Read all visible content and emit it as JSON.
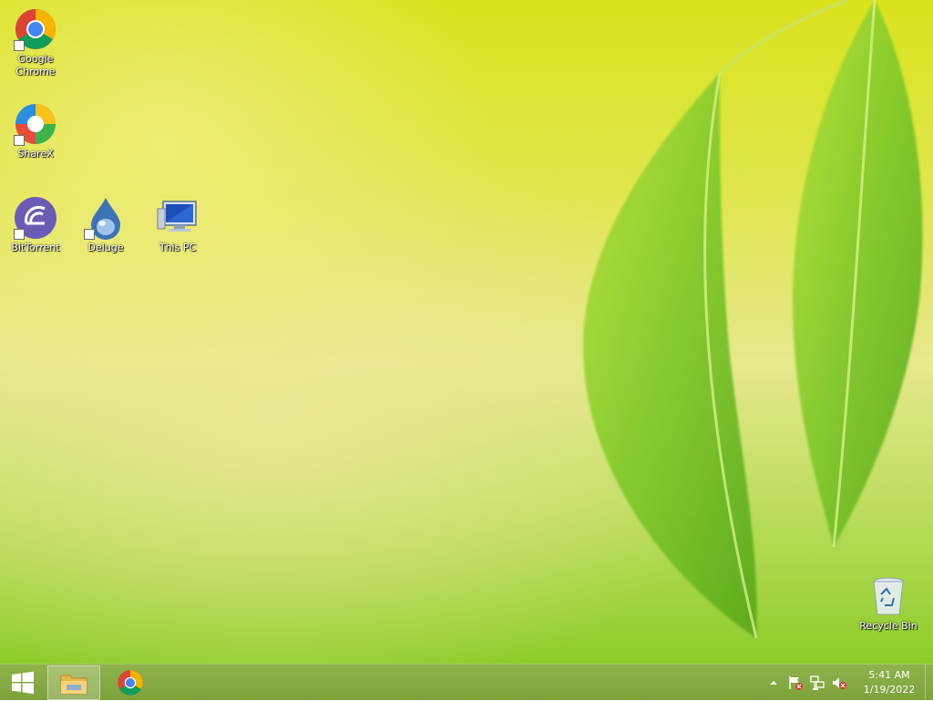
{
  "desktop": {
    "icons": [
      {
        "id": "chrome",
        "label": "Google\nChrome",
        "icon": "chrome-icon",
        "shortcut": true
      },
      {
        "id": "sharex",
        "label": "ShareX",
        "icon": "sharex-icon",
        "shortcut": true
      },
      {
        "id": "bittorrent",
        "label": "BitTorrent",
        "icon": "bittorrent-icon",
        "shortcut": true
      },
      {
        "id": "deluge",
        "label": "Deluge",
        "icon": "deluge-icon",
        "shortcut": true
      },
      {
        "id": "thispc",
        "label": "This PC",
        "icon": "computer-icon",
        "shortcut": false
      },
      {
        "id": "recyclebin",
        "label": "Recycle Bin",
        "icon": "recycle-bin-icon",
        "shortcut": false
      }
    ]
  },
  "taskbar": {
    "start_icon": "windows-logo-icon",
    "pinned": [
      {
        "id": "explorer",
        "icon": "file-explorer-icon",
        "active": true
      },
      {
        "id": "chrome",
        "icon": "chrome-icon",
        "active": false
      }
    ],
    "tray": {
      "icons": [
        "show-hidden-icons-icon",
        "action-center-flag-icon",
        "network-icon",
        "volume-muted-icon"
      ]
    },
    "clock": {
      "time": "5:41 AM",
      "date": "1/19/2022"
    }
  },
  "colors": {
    "taskbar": "#7da23c",
    "wallpaper_yellow": "#e0e650",
    "wallpaper_green": "#8ccc2a",
    "leaf": "#7ec82a"
  }
}
